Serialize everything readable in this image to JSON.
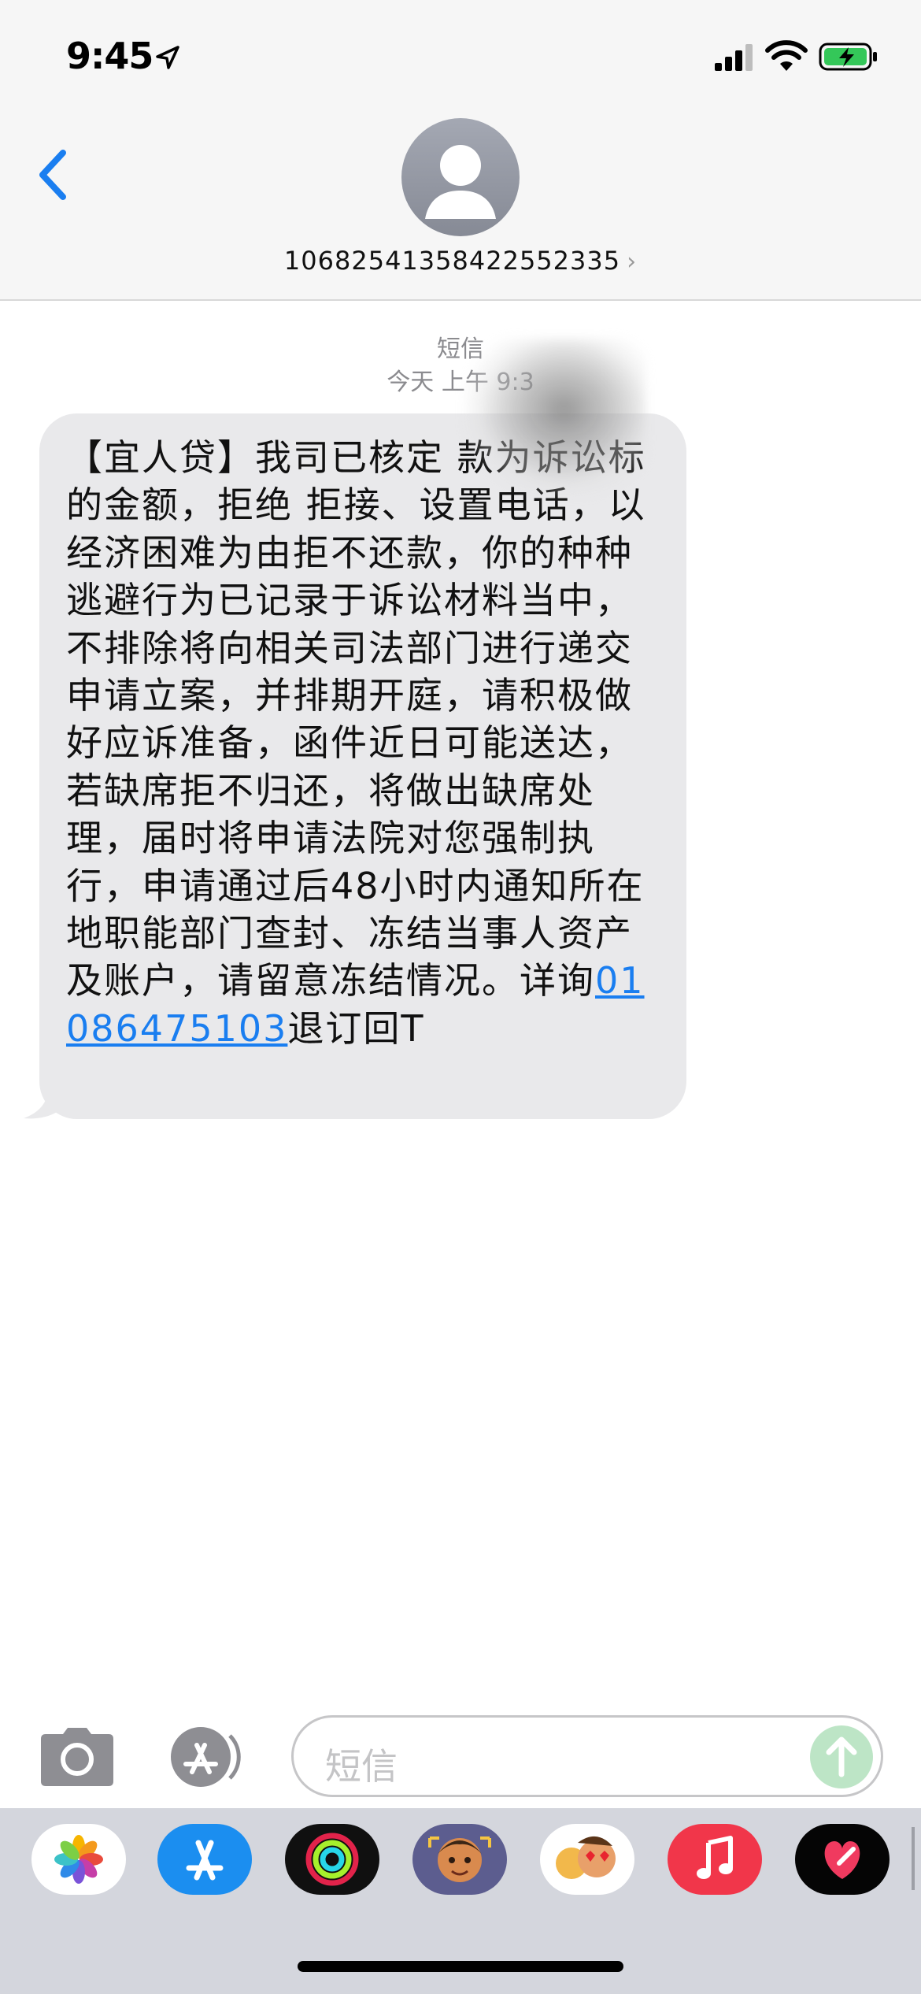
{
  "status_bar": {
    "time": "9:45",
    "icons": [
      "location-arrow-icon",
      "cellular-signal-icon",
      "wifi-icon",
      "battery-charging-icon"
    ],
    "battery_color": "#34c759"
  },
  "header": {
    "back_icon": "chevron-left-icon",
    "contact_number": "10682541358422552335",
    "contact_chevron": "›"
  },
  "conversation": {
    "message_type": "短信",
    "timestamp": "今天 上午 9:3",
    "message": {
      "text_before_link": "【宜人贷】我司已核定 款为诉讼标的金额，拒绝 拒接、设置电话，以经济困难为由拒不还款，你的种种逃避行为已记录于诉讼材料当中，不排除将向相关司法部门进行递交申请立案，并排期开庭，请积极做好应诉准备，函件近日可能送达，若缺席拒不归还，将做出缺席处理，届时将申请法院对您强制执行，申请通过后48小时内通知所在地职能部门查封、冻结当事人资产及账户，请留意冻结情况。详询",
      "link_text": "01086475103",
      "text_after_link": "退订回T"
    }
  },
  "composer": {
    "placeholder": "短信",
    "camera_icon": "camera-icon",
    "apps_icon": "app-store-icon",
    "send_icon": "arrow-up-icon"
  },
  "app_strip": {
    "apps": [
      "photos-icon",
      "app-store-icon",
      "activity-icon",
      "memoji-icon",
      "animoji-stickers-icon",
      "music-icon",
      "digital-touch-icon"
    ]
  },
  "colors": {
    "accent_blue": "#1a7ef0",
    "bubble_gray": "#e9e9eb",
    "header_bg": "#f6f6f6",
    "strip_bg": "#d4d6dd"
  }
}
